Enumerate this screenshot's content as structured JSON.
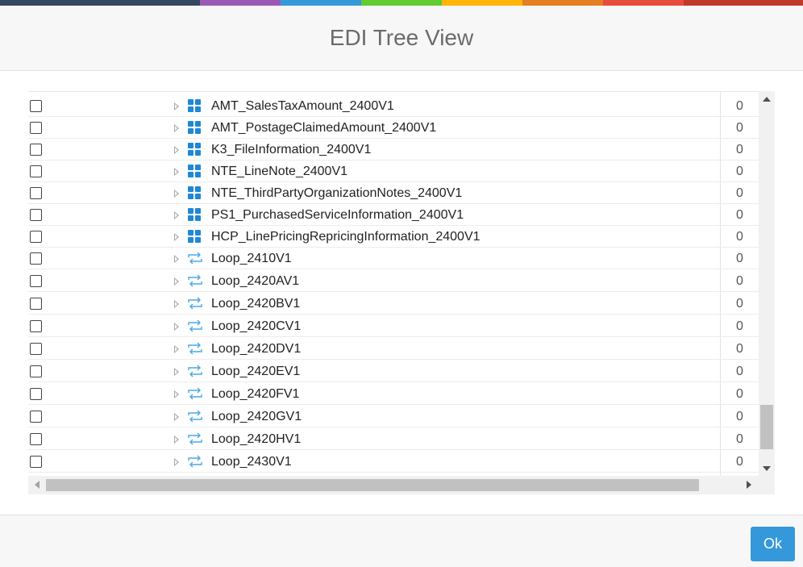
{
  "colors": {
    "strip": [
      "#34495e",
      "#9b59b6",
      "#3498db",
      "#62cb31",
      "#ffb606",
      "#e67e22",
      "#e74c3c",
      "#c0392b"
    ],
    "accent": "#3498db",
    "segment_icon": "#1e88d6",
    "loop_icon": "#4aa8e8"
  },
  "dialog": {
    "title": "EDI Tree View"
  },
  "tree": {
    "rows": [
      {
        "label": "AMT_SalesTaxAmount_2400V1",
        "count": "0",
        "icon": "grid-icon"
      },
      {
        "label": "AMT_PostageClaimedAmount_2400V1",
        "count": "0",
        "icon": "grid-icon"
      },
      {
        "label": "K3_FileInformation_2400V1",
        "count": "0",
        "icon": "grid-icon"
      },
      {
        "label": "NTE_LineNote_2400V1",
        "count": "0",
        "icon": "grid-icon"
      },
      {
        "label": "NTE_ThirdPartyOrganizationNotes_2400V1",
        "count": "0",
        "icon": "grid-icon"
      },
      {
        "label": "PS1_PurchasedServiceInformation_2400V1",
        "count": "0",
        "icon": "grid-icon"
      },
      {
        "label": "HCP_LinePricingRepricingInformation_2400V1",
        "count": "0",
        "icon": "grid-icon"
      },
      {
        "label": "Loop_2410V1",
        "count": "0",
        "icon": "loop-icon"
      },
      {
        "label": "Loop_2420AV1",
        "count": "0",
        "icon": "loop-icon"
      },
      {
        "label": "Loop_2420BV1",
        "count": "0",
        "icon": "loop-icon"
      },
      {
        "label": "Loop_2420CV1",
        "count": "0",
        "icon": "loop-icon"
      },
      {
        "label": "Loop_2420DV1",
        "count": "0",
        "icon": "loop-icon"
      },
      {
        "label": "Loop_2420EV1",
        "count": "0",
        "icon": "loop-icon"
      },
      {
        "label": "Loop_2420FV1",
        "count": "0",
        "icon": "loop-icon"
      },
      {
        "label": "Loop_2420GV1",
        "count": "0",
        "icon": "loop-icon"
      },
      {
        "label": "Loop_2420HV1",
        "count": "0",
        "icon": "loop-icon"
      },
      {
        "label": "Loop_2430V1",
        "count": "0",
        "icon": "loop-icon"
      }
    ]
  },
  "footer": {
    "ok_label": "Ok"
  }
}
